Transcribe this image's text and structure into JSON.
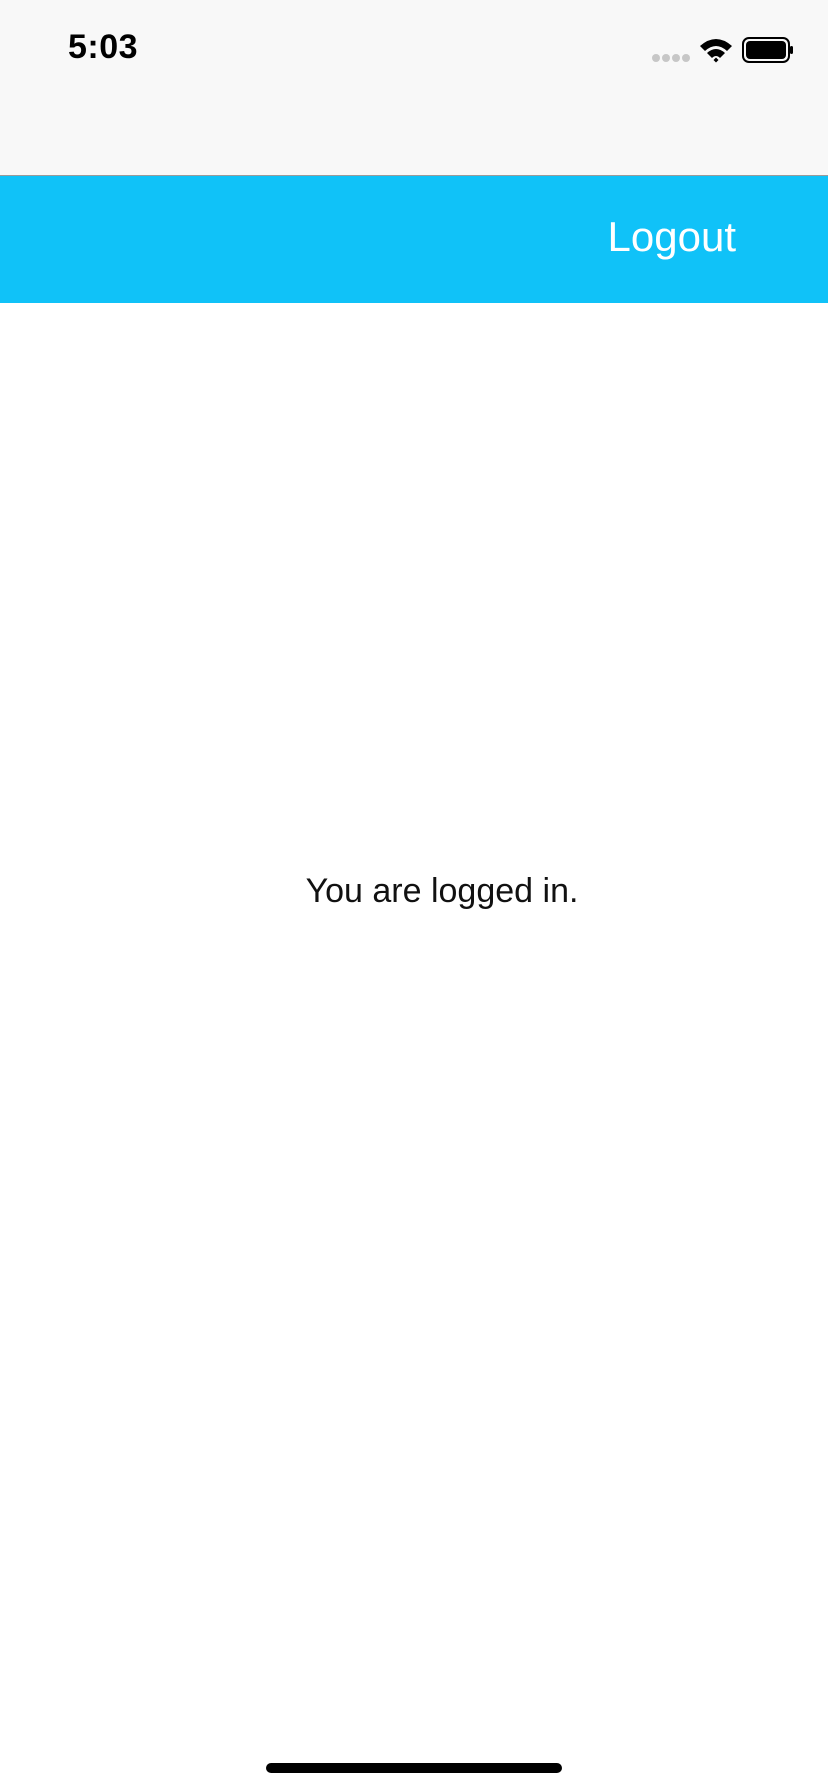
{
  "status_bar": {
    "time": "5:03",
    "signal_icon": "cellular-signal-icon",
    "wifi_icon": "wifi-icon",
    "battery_icon": "battery-icon"
  },
  "header": {
    "logout_label": "Logout"
  },
  "main": {
    "message": "You are logged in."
  },
  "colors": {
    "accent": "#10C2F8",
    "status_background": "#F8F8F8",
    "text": "#111111",
    "button_text": "#FFFFFF"
  }
}
